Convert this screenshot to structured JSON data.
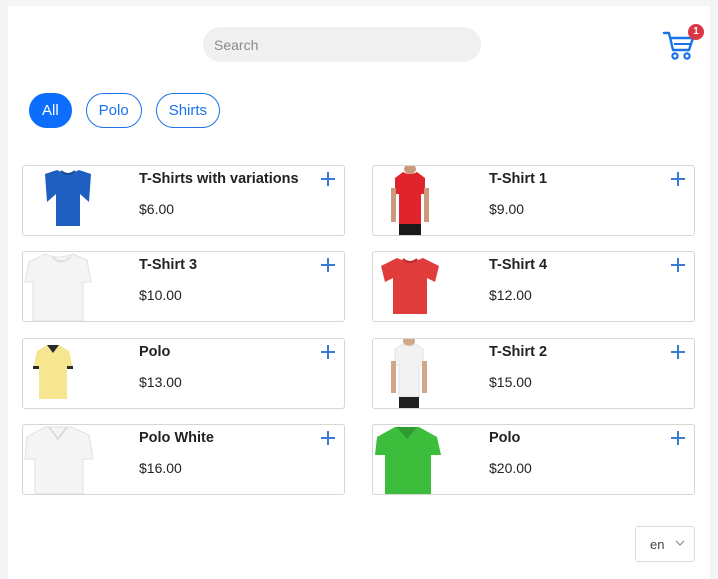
{
  "search": {
    "placeholder": "Search",
    "value": ""
  },
  "cart": {
    "count": "1",
    "icon": "cart-icon",
    "color": "#1a73e8",
    "badge_color": "#dc3545"
  },
  "filters": [
    {
      "label": "All",
      "active": true
    },
    {
      "label": "Polo",
      "active": false
    },
    {
      "label": "Shirts",
      "active": false
    }
  ],
  "products": [
    {
      "name": "T-Shirts with variations",
      "price": "$6.00",
      "image": "blue-tshirt",
      "color": "#1f5fbf"
    },
    {
      "name": "T-Shirt 1",
      "price": "$9.00",
      "image": "red-tshirt-model",
      "color": "#e0242e"
    },
    {
      "name": "T-Shirt 3",
      "price": "$10.00",
      "image": "white-tshirt",
      "color": "#f4f4f4"
    },
    {
      "name": "T-Shirt 4",
      "price": "$12.00",
      "image": "red-tshirt",
      "color": "#e03c3c"
    },
    {
      "name": "Polo",
      "price": "$13.00",
      "image": "yellow-polo",
      "color": "#f5e68f"
    },
    {
      "name": "T-Shirt 2",
      "price": "$15.00",
      "image": "white-tshirt-model",
      "color": "#f2f2f2"
    },
    {
      "name": "Polo White",
      "price": "$16.00",
      "image": "white-polo",
      "color": "#f5f5f5"
    },
    {
      "name": "Polo",
      "price": "$20.00",
      "image": "green-polo",
      "color": "#3cbd3c"
    }
  ],
  "language": {
    "value": "en"
  },
  "accent": "#0d6efd"
}
